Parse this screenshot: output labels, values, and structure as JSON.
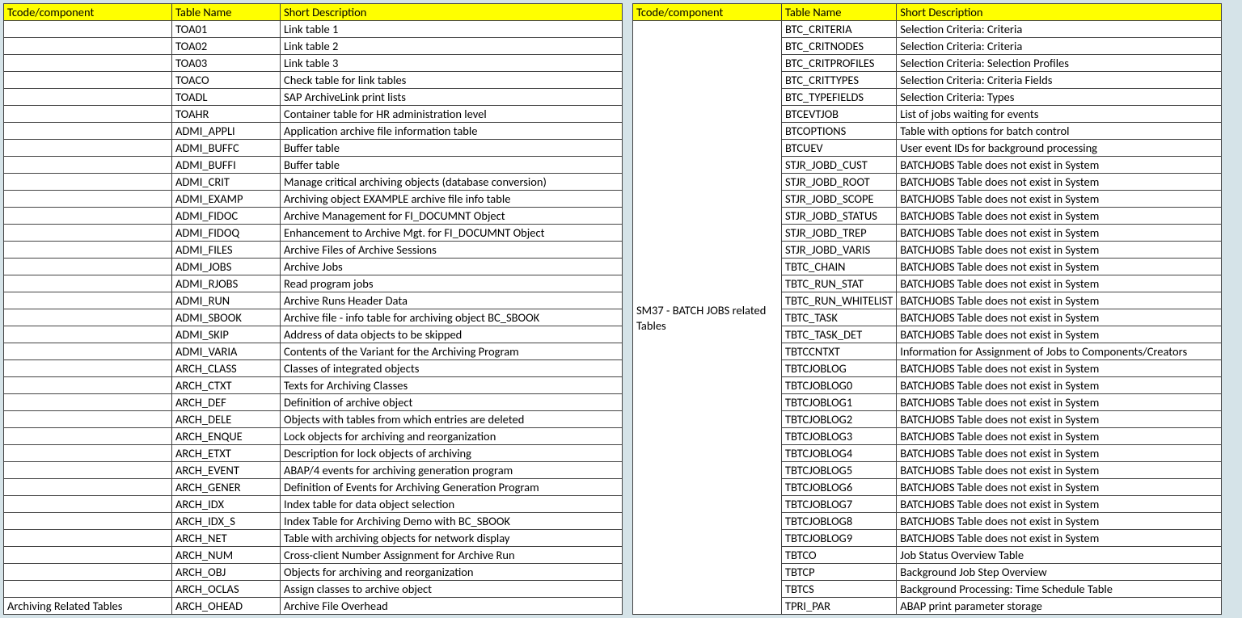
{
  "headers": {
    "comp": "Tcode/component",
    "name": "Table Name",
    "desc": "Short Description"
  },
  "left": {
    "component": "Archiving Related Tables",
    "rows": [
      {
        "name": "TOA01",
        "desc": "Link table 1"
      },
      {
        "name": "TOA02",
        "desc": "Link table 2"
      },
      {
        "name": "TOA03",
        "desc": "Link table 3"
      },
      {
        "name": "TOACO",
        "desc": "Check table for link tables"
      },
      {
        "name": "TOADL",
        "desc": "SAP ArchiveLink print lists"
      },
      {
        "name": "TOAHR",
        "desc": "Container table for HR administration level"
      },
      {
        "name": "ADMI_APPLI",
        "desc": "Application archive file information table"
      },
      {
        "name": "ADMI_BUFFC",
        "desc": "Buffer table"
      },
      {
        "name": "ADMI_BUFFI",
        "desc": "Buffer table"
      },
      {
        "name": "ADMI_CRIT",
        "desc": "Manage critical archiving objects (database conversion)"
      },
      {
        "name": "ADMI_EXAMP",
        "desc": "Archiving object EXAMPLE archive file info table"
      },
      {
        "name": "ADMI_FIDOC",
        "desc": "Archive Management for FI_DOCUMNT Object"
      },
      {
        "name": "ADMI_FIDOQ",
        "desc": "Enhancement to Archive Mgt. for FI_DOCUMNT Object"
      },
      {
        "name": "ADMI_FILES",
        "desc": "Archive Files of Archive Sessions"
      },
      {
        "name": "ADMI_JOBS",
        "desc": "Archive Jobs"
      },
      {
        "name": "ADMI_RJOBS",
        "desc": "Read program jobs"
      },
      {
        "name": "ADMI_RUN",
        "desc": "Archive Runs Header Data"
      },
      {
        "name": "ADMI_SBOOK",
        "desc": "Archive file - info table for archiving object BC_SBOOK"
      },
      {
        "name": "ADMI_SKIP",
        "desc": "Address of data objects to be skipped"
      },
      {
        "name": "ADMI_VARIA",
        "desc": "Contents of the Variant for the Archiving Program"
      },
      {
        "name": "ARCH_CLASS",
        "desc": "Classes of integrated objects"
      },
      {
        "name": "ARCH_CTXT",
        "desc": "Texts for Archiving Classes"
      },
      {
        "name": "ARCH_DEF",
        "desc": "Definition of archive object"
      },
      {
        "name": "ARCH_DELE",
        "desc": "Objects with tables from which entries are deleted"
      },
      {
        "name": "ARCH_ENQUE",
        "desc": "Lock objects for archiving and reorganization"
      },
      {
        "name": "ARCH_ETXT",
        "desc": "Description for lock objects of archiving"
      },
      {
        "name": "ARCH_EVENT",
        "desc": "ABAP/4 events for archiving generation program"
      },
      {
        "name": "ARCH_GENER",
        "desc": "Definition of Events for Archiving Generation Program"
      },
      {
        "name": "ARCH_IDX",
        "desc": "Index table for data object selection"
      },
      {
        "name": "ARCH_IDX_S",
        "desc": "Index Table for Archiving Demo with BC_SBOOK"
      },
      {
        "name": "ARCH_NET",
        "desc": "Table with archiving objects for network display"
      },
      {
        "name": "ARCH_NUM",
        "desc": "Cross-client Number Assignment for Archive Run"
      },
      {
        "name": "ARCH_OBJ",
        "desc": "Objects for archiving and reorganization"
      },
      {
        "name": "ARCH_OCLAS",
        "desc": "Assign classes to archive object"
      },
      {
        "name": "ARCH_OHEAD",
        "desc": "Archive File Overhead"
      }
    ]
  },
  "right": {
    "component": "SM37 - BATCH JOBS related Tables",
    "rows": [
      {
        "name": "BTC_CRITERIA",
        "desc": "Selection Criteria: Criteria"
      },
      {
        "name": "BTC_CRITNODES",
        "desc": "Selection Criteria: Criteria"
      },
      {
        "name": "BTC_CRITPROFILES",
        "desc": "Selection Criteria: Selection Profiles"
      },
      {
        "name": "BTC_CRITTYPES",
        "desc": "Selection Criteria: Criteria Fields"
      },
      {
        "name": "BTC_TYPEFIELDS",
        "desc": "Selection Criteria: Types"
      },
      {
        "name": "BTCEVTJOB",
        "desc": "List of jobs waiting for events"
      },
      {
        "name": "BTCOPTIONS",
        "desc": "Table with options for batch control"
      },
      {
        "name": "BTCUEV",
        "desc": "User event IDs for background processing"
      },
      {
        "name": "STJR_JOBD_CUST",
        "desc": "BATCHJOBS Table does not exist in System"
      },
      {
        "name": "STJR_JOBD_ROOT",
        "desc": "BATCHJOBS Table does not exist in System"
      },
      {
        "name": "STJR_JOBD_SCOPE",
        "desc": "BATCHJOBS Table does not exist in System"
      },
      {
        "name": "STJR_JOBD_STATUS",
        "desc": "BATCHJOBS Table does not exist in System"
      },
      {
        "name": "STJR_JOBD_TREP",
        "desc": "BATCHJOBS Table does not exist in System"
      },
      {
        "name": "STJR_JOBD_VARIS",
        "desc": "BATCHJOBS Table does not exist in System"
      },
      {
        "name": "TBTC_CHAIN",
        "desc": "BATCHJOBS Table does not exist in System"
      },
      {
        "name": "TBTC_RUN_STAT",
        "desc": "BATCHJOBS Table does not exist in System"
      },
      {
        "name": "TBTC_RUN_WHITELIST",
        "desc": "BATCHJOBS Table does not exist in System"
      },
      {
        "name": "TBTC_TASK",
        "desc": "BATCHJOBS Table does not exist in System"
      },
      {
        "name": "TBTC_TASK_DET",
        "desc": "BATCHJOBS Table does not exist in System"
      },
      {
        "name": "TBTCCNTXT",
        "desc": "Information for Assignment of Jobs to Components/Creators"
      },
      {
        "name": "TBTCJOBLOG",
        "desc": "BATCHJOBS Table does not exist in System"
      },
      {
        "name": "TBTCJOBLOG0",
        "desc": "BATCHJOBS Table does not exist in System"
      },
      {
        "name": "TBTCJOBLOG1",
        "desc": "BATCHJOBS Table does not exist in System"
      },
      {
        "name": "TBTCJOBLOG2",
        "desc": "BATCHJOBS Table does not exist in System"
      },
      {
        "name": "TBTCJOBLOG3",
        "desc": "BATCHJOBS Table does not exist in System"
      },
      {
        "name": "TBTCJOBLOG4",
        "desc": "BATCHJOBS Table does not exist in System"
      },
      {
        "name": "TBTCJOBLOG5",
        "desc": "BATCHJOBS Table does not exist in System"
      },
      {
        "name": "TBTCJOBLOG6",
        "desc": "BATCHJOBS Table does not exist in System"
      },
      {
        "name": "TBTCJOBLOG7",
        "desc": "BATCHJOBS Table does not exist in System"
      },
      {
        "name": "TBTCJOBLOG8",
        "desc": "BATCHJOBS Table does not exist in System"
      },
      {
        "name": "TBTCJOBLOG9",
        "desc": "BATCHJOBS Table does not exist in System"
      },
      {
        "name": "TBTCO",
        "desc": "Job Status Overview Table"
      },
      {
        "name": "TBTCP",
        "desc": "Background Job Step Overview"
      },
      {
        "name": "TBTCS",
        "desc": "Background Processing: Time Schedule Table"
      },
      {
        "name": "TPRI_PAR",
        "desc": "ABAP print parameter storage"
      }
    ]
  }
}
